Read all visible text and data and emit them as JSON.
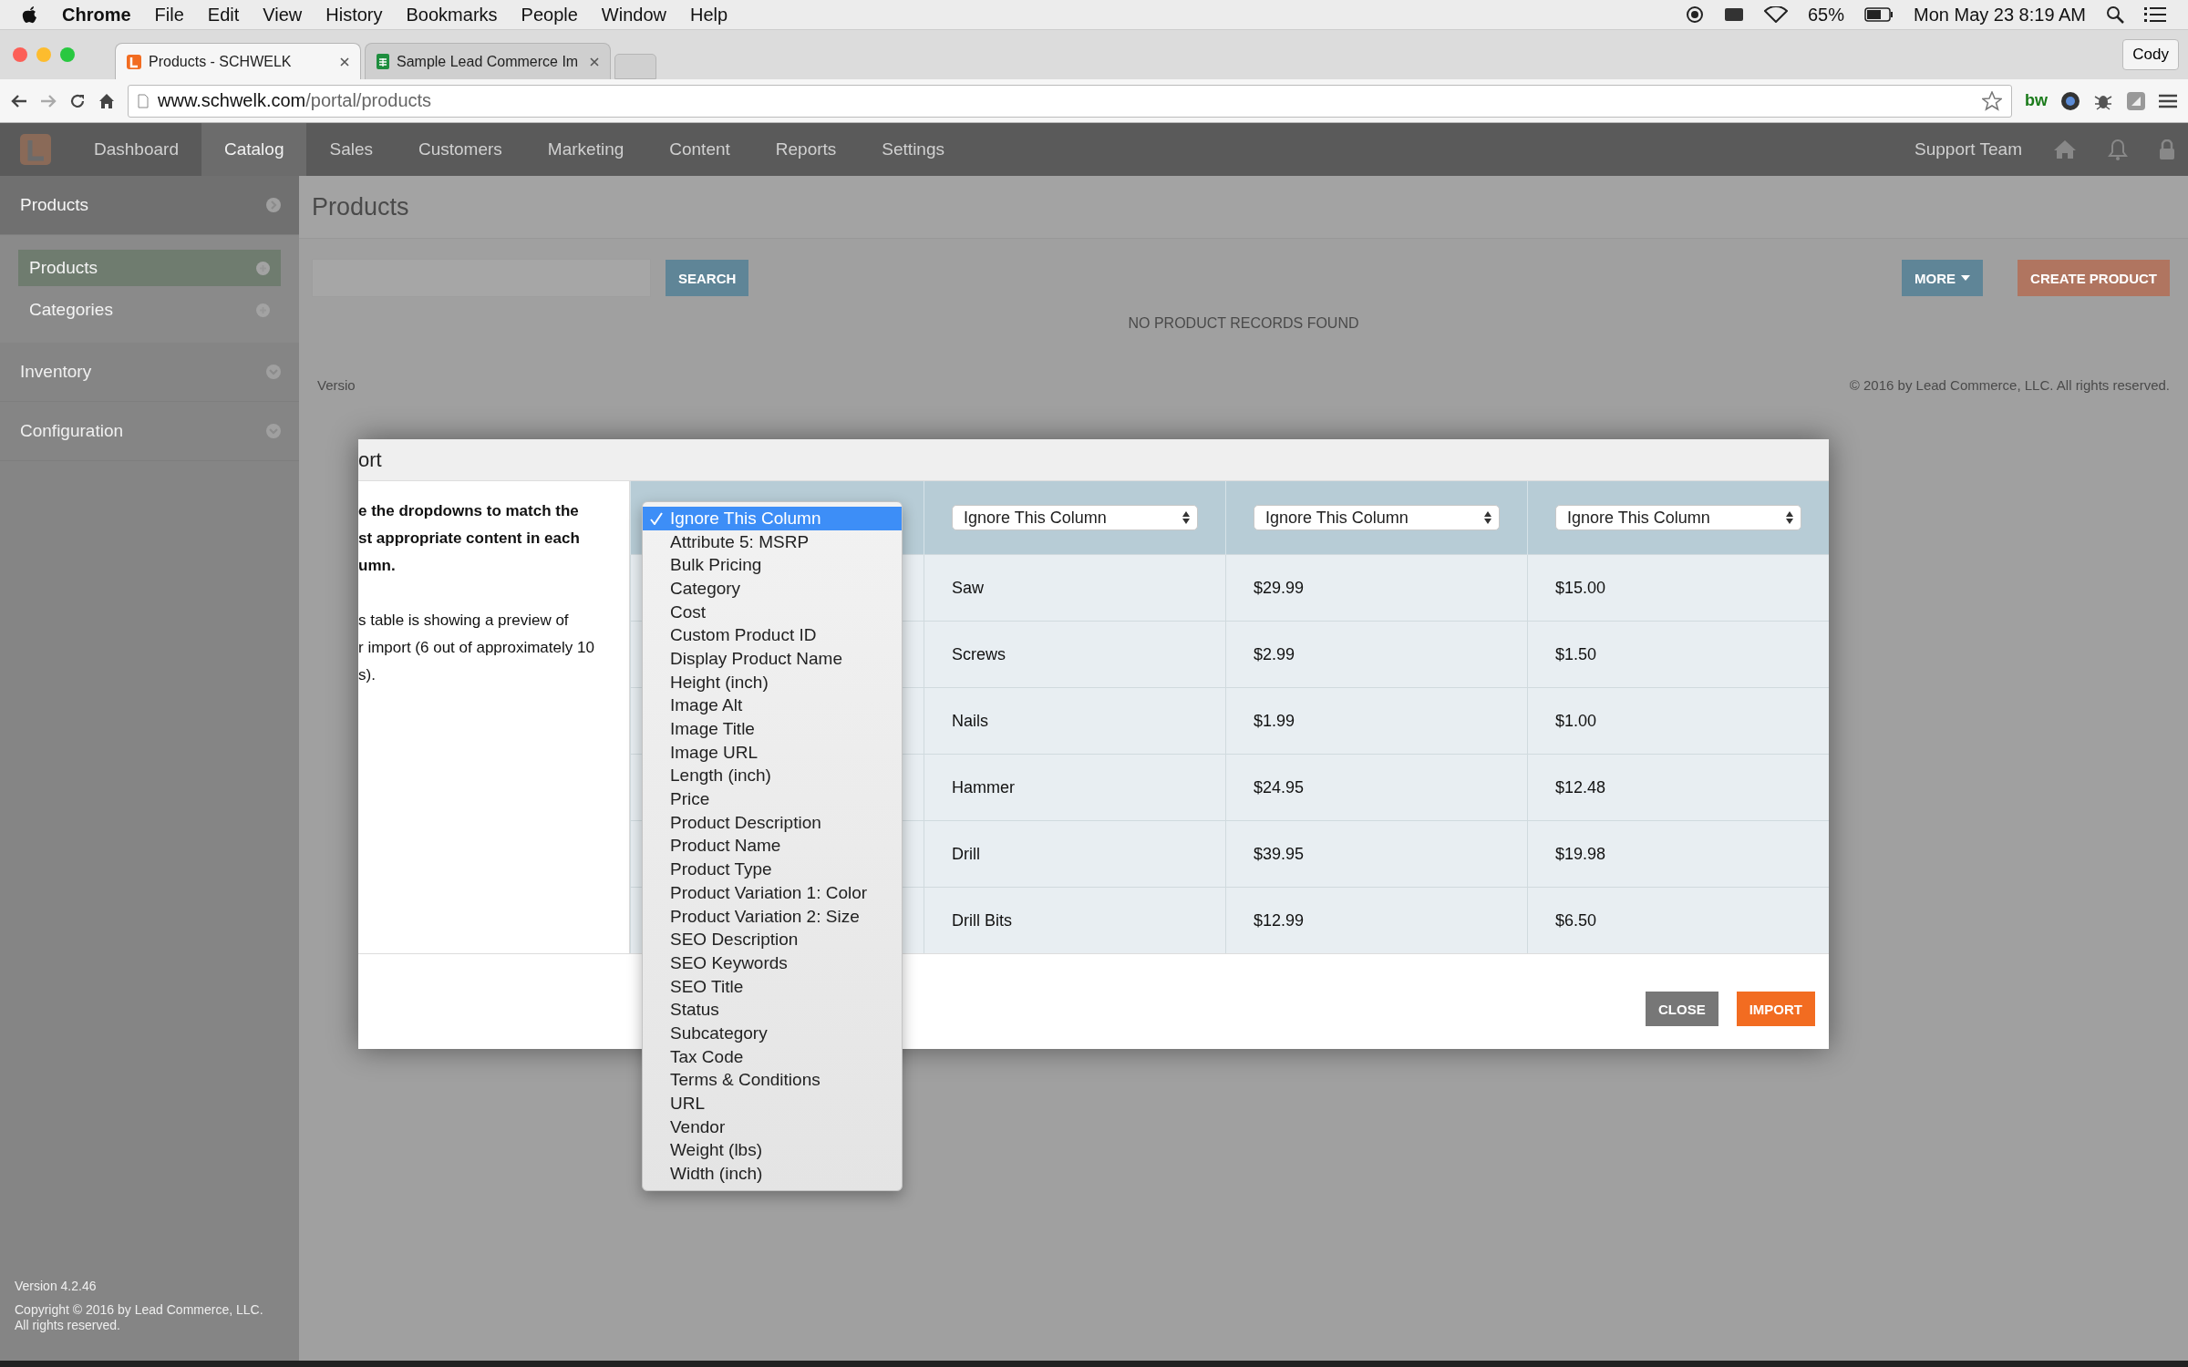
{
  "menu_bar": {
    "app": "Chrome",
    "menus": [
      "File",
      "Edit",
      "View",
      "History",
      "Bookmarks",
      "People",
      "Window",
      "Help"
    ],
    "battery": "65%",
    "clock": "Mon May 23  8:19 AM"
  },
  "browser": {
    "tabs": [
      {
        "title": "Products - SCHWELK",
        "selected": true,
        "kind": "site"
      },
      {
        "title": "Sample Lead Commerce Im",
        "selected": false,
        "kind": "sheet"
      }
    ],
    "profile": "Cody",
    "url_host": "www.schwelk.com",
    "url_path": "/portal/products",
    "extension_label": "bw"
  },
  "app": {
    "nav": [
      {
        "label": "Dashboard",
        "selected": false
      },
      {
        "label": "Catalog",
        "selected": true
      },
      {
        "label": "Sales",
        "selected": false
      },
      {
        "label": "Customers",
        "selected": false
      },
      {
        "label": "Marketing",
        "selected": false
      },
      {
        "label": "Content",
        "selected": false
      },
      {
        "label": "Reports",
        "selected": false
      },
      {
        "label": "Settings",
        "selected": false
      }
    ],
    "user": "Support Team",
    "sidebar": {
      "sections": [
        {
          "label": "Products",
          "expanded": true,
          "items": [
            {
              "label": "Products",
              "selected": true
            },
            {
              "label": "Categories",
              "selected": false
            }
          ]
        },
        {
          "label": "Inventory",
          "expanded": false
        },
        {
          "label": "Configuration",
          "expanded": false
        }
      ],
      "version": "Version 4.2.46",
      "copyright": "Copyright © 2016 by Lead Commerce, LLC.",
      "rights": "All rights reserved."
    },
    "page": {
      "title": "Products",
      "search_button": "SEARCH",
      "more_button": "MORE",
      "create_button": "CREATE PRODUCT",
      "empty_message": "NO PRODUCT RECORDS FOUND",
      "footer_left": "Versio",
      "footer_right": "© 2016 by Lead Commerce, LLC. All rights reserved."
    }
  },
  "modal": {
    "title": "ort",
    "instructions_bold": [
      "e the dropdowns to match the",
      "st appropriate content in each",
      "umn."
    ],
    "instructions": [
      "s table is showing a preview of",
      "r import (6 out of approximately 10",
      "s)."
    ],
    "column_selects": [
      {
        "open": true
      },
      {
        "value": "Ignore This Column",
        "open": false
      },
      {
        "value": "Ignore This Column",
        "open": false
      },
      {
        "value": "Ignore This Column",
        "open": false
      }
    ],
    "rows": [
      {
        "cells": [
          "Saw",
          "$29.99",
          "$15.00"
        ]
      },
      {
        "cells": [
          "Screws",
          "$2.99",
          "$1.50"
        ]
      },
      {
        "cells": [
          "Nails",
          "$1.99",
          "$1.00"
        ]
      },
      {
        "cells": [
          "Hammer",
          "$24.95",
          "$12.48"
        ]
      },
      {
        "cells": [
          "Drill",
          "$39.95",
          "$19.98"
        ]
      },
      {
        "cells": [
          "Drill Bits",
          "$12.99",
          "$6.50"
        ]
      }
    ],
    "dropdown_options": [
      {
        "label": "Ignore This Column",
        "selected": true
      },
      {
        "label": "Attribute 5: MSRP",
        "selected": false
      },
      {
        "label": "Bulk Pricing",
        "selected": false
      },
      {
        "label": "Category",
        "selected": false
      },
      {
        "label": "Cost",
        "selected": false
      },
      {
        "label": "Custom Product ID",
        "selected": false
      },
      {
        "label": "Display Product Name",
        "selected": false
      },
      {
        "label": "Height (inch)",
        "selected": false
      },
      {
        "label": "Image Alt",
        "selected": false
      },
      {
        "label": "Image Title",
        "selected": false
      },
      {
        "label": "Image URL",
        "selected": false
      },
      {
        "label": "Length (inch)",
        "selected": false
      },
      {
        "label": "Price",
        "selected": false
      },
      {
        "label": "Product Description",
        "selected": false
      },
      {
        "label": "Product Name",
        "selected": false
      },
      {
        "label": "Product Type",
        "selected": false
      },
      {
        "label": "Product Variation 1: Color",
        "selected": false
      },
      {
        "label": "Product Variation 2: Size",
        "selected": false
      },
      {
        "label": "SEO Description",
        "selected": false
      },
      {
        "label": "SEO Keywords",
        "selected": false
      },
      {
        "label": "SEO Title",
        "selected": false
      },
      {
        "label": "Status",
        "selected": false
      },
      {
        "label": "Subcategory",
        "selected": false
      },
      {
        "label": "Tax Code",
        "selected": false
      },
      {
        "label": "Terms & Conditions",
        "selected": false
      },
      {
        "label": "URL",
        "selected": false
      },
      {
        "label": "Vendor",
        "selected": false
      },
      {
        "label": "Weight (lbs)",
        "selected": false
      },
      {
        "label": "Width (inch)",
        "selected": false
      }
    ],
    "buttons": [
      {
        "label": "CLOSE",
        "kind": "secondary"
      },
      {
        "label": "IMPORT",
        "kind": "primary"
      }
    ]
  }
}
